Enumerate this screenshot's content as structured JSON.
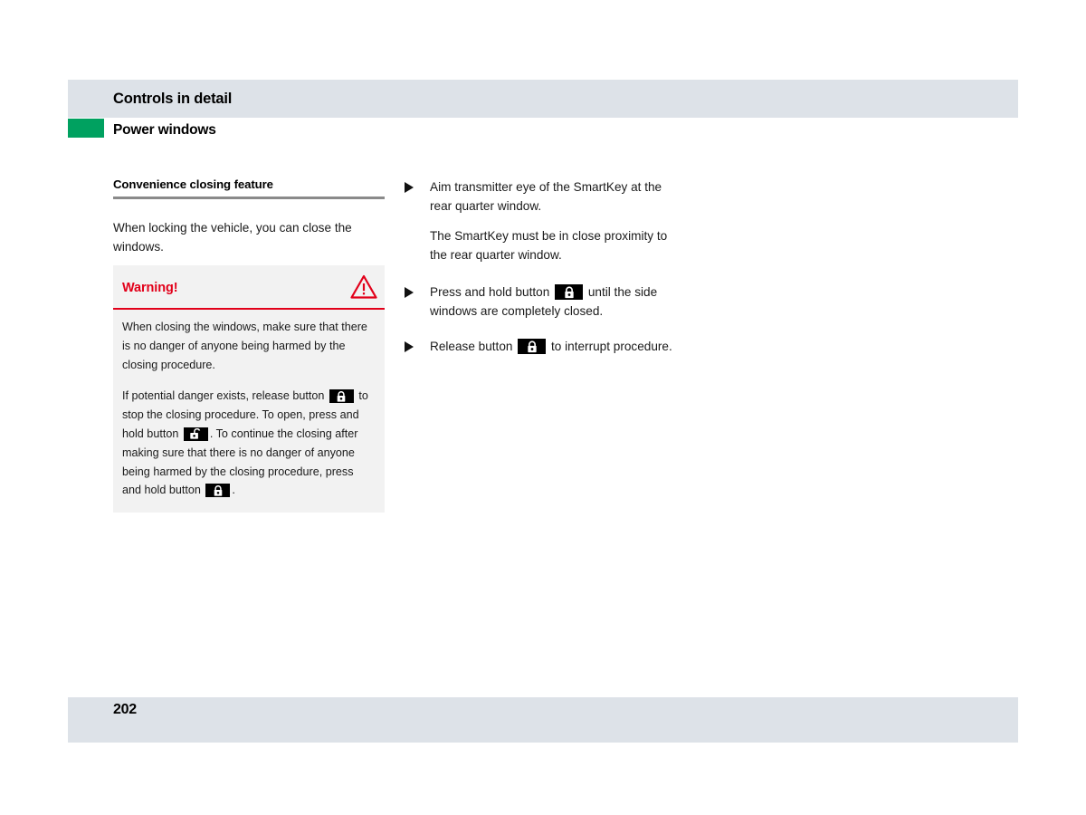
{
  "header": {
    "chapter_title": "Controls in detail",
    "section_title": "Power windows",
    "tab_color": "#00a160",
    "band_color": "#dde2e8"
  },
  "left_column": {
    "subheading": "Convenience closing feature",
    "intro": "When locking the vehicle, you can close the windows.",
    "warning": {
      "label": "Warning!",
      "icon": "warning-triangle-icon",
      "accent_color": "#e2001a",
      "background_color": "#f2f2f2",
      "paragraph_1": "When closing the windows, make sure that there is no danger of anyone being harmed by the closing procedure.",
      "paragraph_2_part_1": "If potential danger exists, release button",
      "paragraph_2_icon_1": "lock-closed-button-icon",
      "paragraph_2_part_2": "to stop the closing procedure. To open, press and hold button",
      "paragraph_2_icon_2": "lock-open-button-icon",
      "paragraph_2_part_3": ". To continue the closing after making sure that there is no danger of anyone being harmed by the closing procedure, press and hold button",
      "paragraph_2_icon_3": "lock-closed-button-icon",
      "paragraph_2_part_4": "."
    }
  },
  "right_column": {
    "bullets": [
      {
        "marker": "triangle-right-bullet-icon",
        "text": "Aim transmitter eye of the SmartKey at the rear quarter window."
      }
    ],
    "note": "The SmartKey must be in close proximity to the rear quarter window.",
    "bullet_2": {
      "marker": "triangle-right-bullet-icon",
      "text_before": "Press and hold button",
      "icon": "lock-closed-button-icon",
      "text_after": "until the side windows are completely closed."
    },
    "bullet_3": {
      "marker": "triangle-right-bullet-icon",
      "text_before": "Release button",
      "icon": "lock-closed-button-icon",
      "text_after": "to interrupt procedure."
    }
  },
  "footer": {
    "page_number": "202",
    "band_color": "#dde2e8"
  }
}
